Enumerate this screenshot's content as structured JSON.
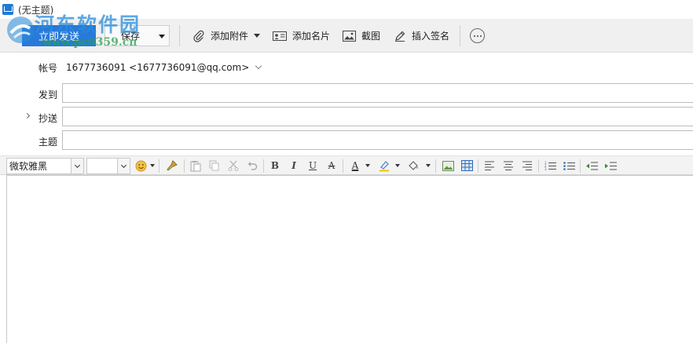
{
  "window": {
    "title": "(无主题)"
  },
  "toolbar": {
    "send_label": "立即发送",
    "save_label": "保存",
    "attach_label": "添加附件",
    "card_label": "添加名片",
    "screenshot_label": "截图",
    "signature_label": "插入签名"
  },
  "fields": {
    "account_label": "帐号",
    "account_value": "1677736091 <1677736091@qq.com>",
    "to_label": "发到",
    "to_value": "",
    "cc_label": "抄送",
    "cc_value": "",
    "subject_label": "主题",
    "subject_value": ""
  },
  "format_bar": {
    "font_family": "微软雅黑",
    "font_size": "",
    "bold_glyph": "B",
    "italic_glyph": "I",
    "underline_glyph": "U",
    "strike_glyph": "A",
    "font_color_glyph": "A"
  },
  "editor": {
    "body": ""
  },
  "watermark": {
    "title": "河东软件园",
    "url": "www.pc0359.cn"
  },
  "colors": {
    "send_button": "#2879d9",
    "toolbar_bg": "#f0f0f0",
    "watermark_blue": "#288cdc",
    "watermark_green": "#28a050"
  }
}
